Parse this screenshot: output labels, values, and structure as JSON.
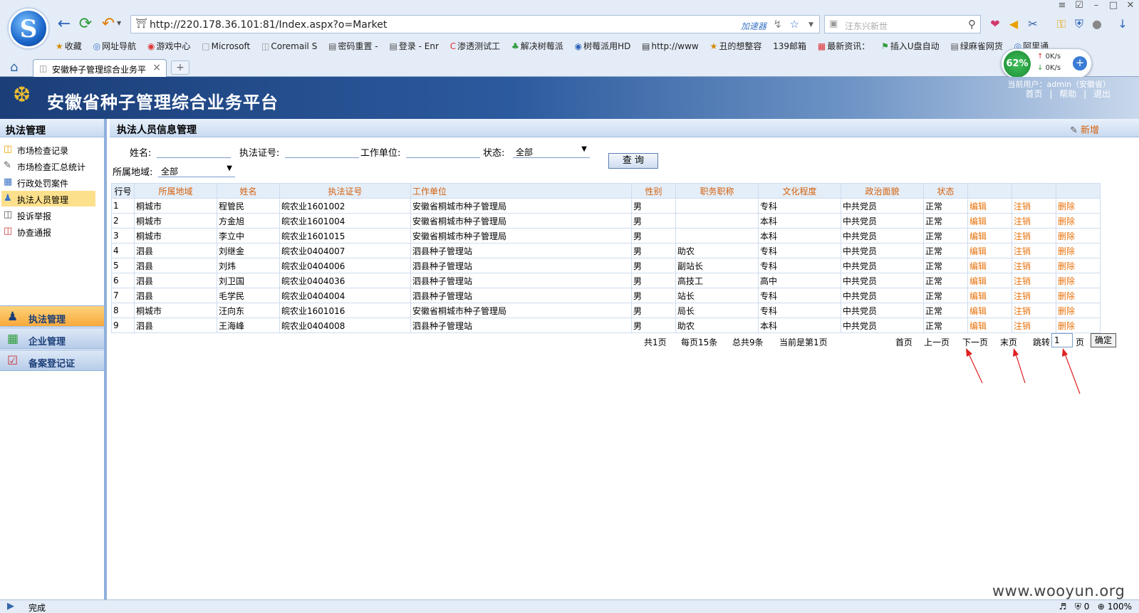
{
  "browser": {
    "url": "http://220.178.36.101:81/Index.aspx?o=Market",
    "accelerator": "加速器",
    "search_placeholder": "汪东兴新世",
    "bookmarks": [
      "收藏",
      "网址导航",
      "游戏中心",
      "Microsoft",
      "Coremail S",
      "密码重置 -",
      "登录 - Enr",
      "渗透测试工",
      "解决树莓派",
      "树莓派用HD",
      "http://www",
      "丑的想整容",
      "139邮箱",
      "最新资讯：",
      "插入U盘自动",
      "绿麻雀网货",
      "阿里通"
    ],
    "tab_title": "安徽种子管理综合业务平",
    "net_percent": "62%",
    "net_up": "0K/s",
    "net_down": "0K/s",
    "status": "完成",
    "zoom": "100%",
    "status_count": "0"
  },
  "header": {
    "title": "安徽省种子管理综合业务平台",
    "current_user": "当前用户：admin（安徽省）",
    "links": [
      "首页",
      "|",
      "帮助",
      "|",
      "退出"
    ]
  },
  "sidebar": {
    "title": "执法管理",
    "items": [
      {
        "label": "市场检查记录"
      },
      {
        "label": "市场检查汇总统计"
      },
      {
        "label": "行政处罚案件"
      },
      {
        "label": "执法人员管理"
      },
      {
        "label": "投诉举报"
      },
      {
        "label": "协查通报"
      }
    ],
    "accordion": [
      {
        "label": "执法管理"
      },
      {
        "label": "企业管理"
      },
      {
        "label": "备案登记证"
      }
    ]
  },
  "main": {
    "title": "执法人员信息管理",
    "add_label": "新增",
    "form": {
      "name_label": "姓名:",
      "cert_label": "执法证号:",
      "unit_label": "工作单位:",
      "status_label": "状态:",
      "status_value": "全部",
      "region_label": "所属地域:",
      "region_value": "全部",
      "query_label": "查 询"
    },
    "table": {
      "headers": [
        "行号",
        "所属地域",
        "姓名",
        "执法证号",
        "工作单位",
        "性别",
        "职务职称",
        "文化程度",
        "政治面貌",
        "状态",
        "",
        "",
        ""
      ],
      "rows": [
        [
          "1",
          "桐城市",
          "程管民",
          "皖农业1601002",
          "安徽省桐城市种子管理局",
          "男",
          "",
          "专科",
          "中共党员",
          "正常",
          "编辑",
          "注销",
          "删除"
        ],
        [
          "2",
          "桐城市",
          "方金旭",
          "皖农业1601004",
          "安徽省桐城市种子管理局",
          "男",
          "",
          "本科",
          "中共党员",
          "正常",
          "编辑",
          "注销",
          "删除"
        ],
        [
          "3",
          "桐城市",
          "李立中",
          "皖农业1601015",
          "安徽省桐城市种子管理局",
          "男",
          "",
          "本科",
          "中共党员",
          "正常",
          "编辑",
          "注销",
          "删除"
        ],
        [
          "4",
          "泗县",
          "刘继金",
          "皖农业0404007",
          "泗县种子管理站",
          "男",
          "助农",
          "专科",
          "中共党员",
          "正常",
          "编辑",
          "注销",
          "删除"
        ],
        [
          "5",
          "泗县",
          "刘炜",
          "皖农业0404006",
          "泗县种子管理站",
          "男",
          "副站长",
          "专科",
          "中共党员",
          "正常",
          "编辑",
          "注销",
          "删除"
        ],
        [
          "6",
          "泗县",
          "刘卫国",
          "皖农业0404036",
          "泗县种子管理站",
          "男",
          "高技工",
          "高中",
          "中共党员",
          "正常",
          "编辑",
          "注销",
          "删除"
        ],
        [
          "7",
          "泗县",
          "毛学民",
          "皖农业0404004",
          "泗县种子管理站",
          "男",
          "站长",
          "专科",
          "中共党员",
          "正常",
          "编辑",
          "注销",
          "删除"
        ],
        [
          "8",
          "桐城市",
          "汪向东",
          "皖农业1601016",
          "安徽省桐城市种子管理局",
          "男",
          "局长",
          "专科",
          "中共党员",
          "正常",
          "编辑",
          "注销",
          "删除"
        ],
        [
          "9",
          "泗县",
          "王海峰",
          "皖农业0404008",
          "泗县种子管理站",
          "男",
          "助农",
          "本科",
          "中共党员",
          "正常",
          "编辑",
          "注销",
          "删除"
        ]
      ]
    },
    "pager": {
      "total_pages": "共1页",
      "per_page": "每页15条",
      "total": "总共9条",
      "current": "当前是第1页",
      "first": "首页",
      "prev": "上一页",
      "next": "下一页",
      "last": "末页",
      "jump": "跳转",
      "jump_value": "1",
      "page_unit": "页",
      "ok": "确定"
    }
  },
  "watermark": "www.wooyun.org"
}
